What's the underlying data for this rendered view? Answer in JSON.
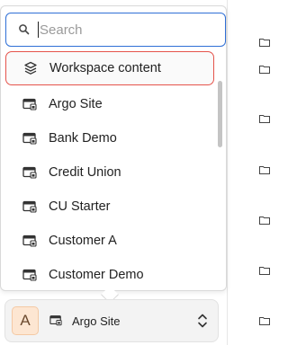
{
  "search": {
    "placeholder": "Search"
  },
  "items": [
    {
      "label": "Workspace content",
      "icon": "layers-icon",
      "selected": true
    },
    {
      "label": "Argo Site",
      "icon": "site-icon"
    },
    {
      "label": "Bank Demo",
      "icon": "site-icon"
    },
    {
      "label": "Credit Union",
      "icon": "site-icon"
    },
    {
      "label": "CU Starter",
      "icon": "site-icon"
    },
    {
      "label": "Customer A",
      "icon": "site-icon"
    },
    {
      "label": "Customer Demo",
      "icon": "site-icon"
    }
  ],
  "selector": {
    "avatar_letter": "A",
    "current_site": "Argo Site",
    "icon": "site-icon"
  },
  "colors": {
    "focus_border": "#2f6fd6",
    "selected_border": "#e5534b",
    "avatar_bg": "#fde6d2"
  }
}
